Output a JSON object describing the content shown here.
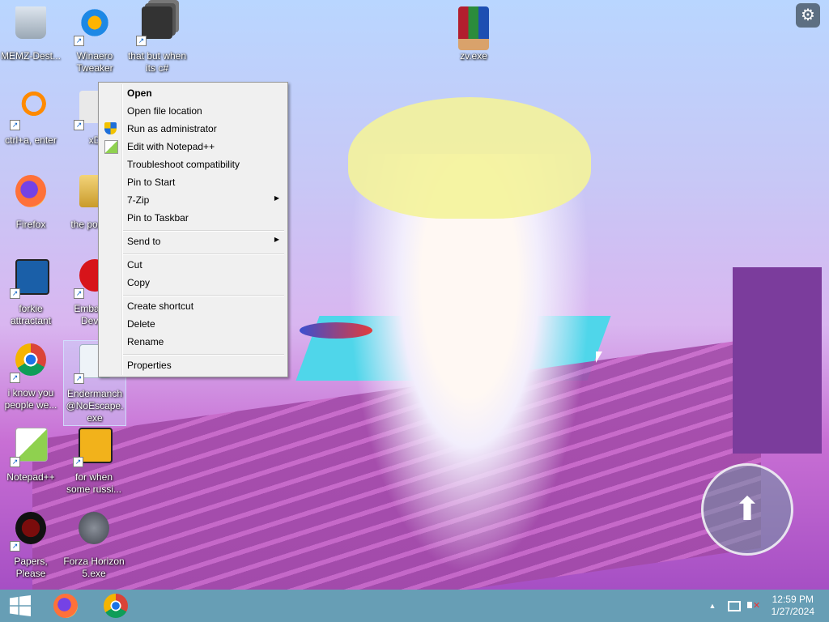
{
  "desktop": {
    "icons": [
      {
        "label": "MEMZ-Dest...",
        "icon": "recycle-bin-icon"
      },
      {
        "label": "Winaero Tweaker",
        "icon": "winaero-icon"
      },
      {
        "label": "that but when its c#",
        "icon": "stacked-windows-icon"
      },
      {
        "label": "zv.exe",
        "icon": "winrar-archive-icon"
      },
      {
        "label": "ctrl+a, enter",
        "icon": "magnifier-icon"
      },
      {
        "label": "xD",
        "icon": "xd-icon"
      },
      {
        "label": "Firefox",
        "icon": "firefox-icon"
      },
      {
        "label": "the po... sh",
        "icon": "folder-icon"
      },
      {
        "label": "forkie attractant",
        "icon": "computer-settings-icon"
      },
      {
        "label": "Embarc... Dev-C",
        "icon": "devcpp-icon"
      },
      {
        "label": "i know you people we...",
        "icon": "chrome-icon"
      },
      {
        "label": "Endermanch@NoEscape.exe",
        "icon": "exe-file-icon"
      },
      {
        "label": "Notepad++",
        "icon": "notepadpp-icon"
      },
      {
        "label": "for when some russi...",
        "icon": "de-app-icon"
      },
      {
        "label": "Papers, Please",
        "icon": "papers-please-icon"
      },
      {
        "label": "Forza Horizon 5.exe",
        "icon": "flash-icon"
      }
    ]
  },
  "context_menu": {
    "items": [
      {
        "label": "Open",
        "bold": true
      },
      {
        "label": "Open file location"
      },
      {
        "label": "Run as administrator",
        "icon": "uac-shield-icon"
      },
      {
        "label": "Edit with Notepad++",
        "icon": "notepadpp-small-icon"
      },
      {
        "label": "Troubleshoot compatibility"
      },
      {
        "label": "Pin to Start"
      },
      {
        "label": "7-Zip",
        "submenu": true
      },
      {
        "label": "Pin to Taskbar"
      },
      {
        "label": "Send to",
        "submenu": true
      },
      {
        "label": "Cut"
      },
      {
        "label": "Copy"
      },
      {
        "label": "Create shortcut"
      },
      {
        "label": "Delete"
      },
      {
        "label": "Rename"
      },
      {
        "label": "Properties"
      }
    ],
    "submenu_glyph": "▶"
  },
  "taskbar": {
    "start_icon": "windows-logo-icon",
    "pinned": [
      "firefox-icon",
      "chrome-icon"
    ],
    "tray_icons": [
      "show-hidden-icons-chevron",
      "network-icon",
      "volume-muted-icon"
    ],
    "tray_chevron": "▲",
    "time": "12:59 PM",
    "date": "1/27/2024"
  },
  "overlay": {
    "settings_icon": "gear-icon",
    "jump_icon": "up-arrow-icon"
  },
  "colors": {
    "taskbar": "#5a96af",
    "menu_bg": "#f0f0f0",
    "menu_border": "#979797",
    "accent": "#0b61c4"
  }
}
